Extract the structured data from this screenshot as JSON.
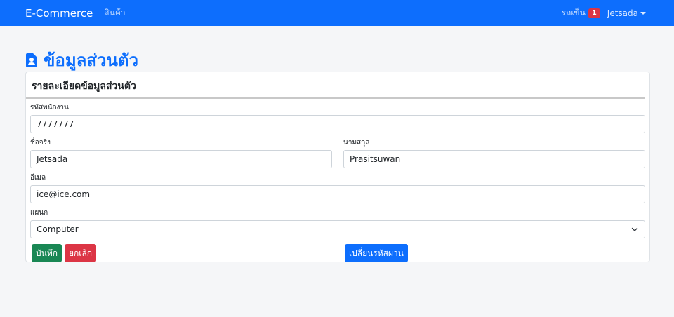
{
  "navbar": {
    "brand": "E-Commerce",
    "products_link": "สินค้า",
    "cart_label": "รถเข็น",
    "cart_count": "1",
    "user_name": "Jetsada"
  },
  "page": {
    "title": "ข้อมูลส่วนตัว",
    "title_icon": "person-badge-icon"
  },
  "card": {
    "header": "รายละเอียดข้อมูลส่วนตัว"
  },
  "form": {
    "employee_id": {
      "label": "รหัสพนักงาน",
      "value": "7777777"
    },
    "first_name": {
      "label": "ชื่อจริง",
      "value": "Jetsada"
    },
    "last_name": {
      "label": "นามสกุล",
      "value": "Prasitsuwan"
    },
    "email": {
      "label": "อีเมล",
      "value": "ice@ice.com"
    },
    "department": {
      "label": "แผนก",
      "selected": "Computer"
    }
  },
  "buttons": {
    "save": "บันทึก",
    "cancel": "ยกเลิก",
    "change_password": "เปลี่ยนรหัสผ่าน"
  },
  "colors": {
    "primary": "#0d6efd",
    "success": "#198754",
    "danger": "#dc3545"
  }
}
